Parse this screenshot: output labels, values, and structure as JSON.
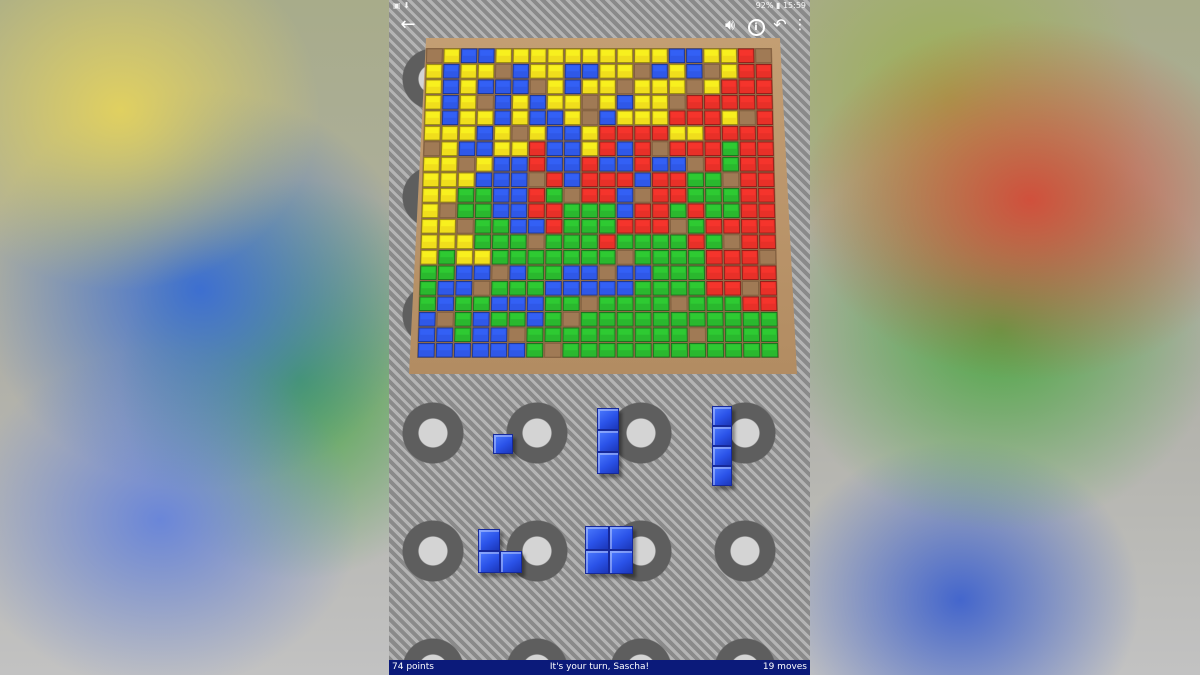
{
  "status_bar": {
    "left_icons": [
      "gallery-icon",
      "download-icon"
    ],
    "battery": "92%",
    "time": "15:59"
  },
  "toolbar": {
    "icons": [
      "back-arrow-icon",
      "speaker-icon",
      "info-icon",
      "undo-icon",
      "overflow-menu-icon"
    ]
  },
  "board": {
    "size": 20,
    "rows": [
      "YYBBYYYYYYYYYYBBYYRR",
      "YBYYBBYYBBYYBBYBBYRR",
      "YBYBBBYYBYYBYYYBYRRR",
      "YBYYBYBYYBYBYYYRRRRR",
      "YBYYBYBBYYBYYYRRRYRR",
      "YYYBYYYBBYRRRRYYRRRR",
      "YYBBYYRBBYRBRRRRRGRR",
      "YYYYBBRBBRBBRBBGRGRR",
      "YYYBBBRRBRRRBRRGGRRR",
      "YYGGBBRGRRRBGRRGGGRR",
      "YGGGBBRRGGGBRRGRGGRR",
      "YYGGGBBRGGGRRRGGRRRR",
      "YYYGGGGGGGRGGGGRGGRR",
      "YGYYGGGGGGGGGGGGRRRR",
      "GGBBBBGGBBBBBGGGRRRR",
      "GBBBGGGBBBBBGGGGRRRR",
      "GBGGBBBGGBGGGGGGGGRR",
      "BBGBGGBGGGGGGGGGGGGG",
      "BBGBBGGGGGGGGGGGGGGG",
      "BBBBBBGGGGGGGGGGGGGG"
    ],
    "empty_cells": [
      [
        0,
        0
      ],
      [
        0,
        19
      ],
      [
        1,
        4
      ],
      [
        1,
        12
      ],
      [
        2,
        6
      ],
      [
        2,
        15
      ],
      [
        3,
        3
      ],
      [
        3,
        9
      ],
      [
        4,
        18
      ],
      [
        5,
        5
      ],
      [
        6,
        13
      ],
      [
        7,
        2
      ],
      [
        8,
        17
      ],
      [
        9,
        8
      ],
      [
        10,
        1
      ],
      [
        11,
        14
      ],
      [
        12,
        6
      ],
      [
        13,
        11
      ],
      [
        14,
        4
      ],
      [
        15,
        18
      ],
      [
        16,
        9
      ],
      [
        17,
        1
      ],
      [
        18,
        15
      ],
      [
        19,
        7
      ],
      [
        3,
        14
      ],
      [
        8,
        6
      ],
      [
        11,
        2
      ],
      [
        16,
        14
      ],
      [
        6,
        0
      ],
      [
        13,
        19
      ],
      [
        1,
        16
      ],
      [
        18,
        5
      ],
      [
        9,
        12
      ],
      [
        4,
        9
      ],
      [
        15,
        3
      ],
      [
        12,
        17
      ],
      [
        2,
        11
      ],
      [
        17,
        8
      ],
      [
        7,
        15
      ],
      [
        14,
        10
      ]
    ],
    "colors": {
      "Y": "#f0de1c",
      "B": "#2f58e8",
      "R": "#e83028",
      "G": "#2ab82e"
    }
  },
  "tray": {
    "piece_color": "#2f58e8",
    "pieces": [
      {
        "id": "monomino",
        "cells": [
          [
            0,
            0
          ]
        ]
      },
      {
        "id": "domino-vertical",
        "cells": [
          [
            0,
            0
          ],
          [
            1,
            0
          ],
          [
            2,
            0
          ]
        ]
      },
      {
        "id": "tetromino-vertical",
        "cells": [
          [
            0,
            0
          ],
          [
            1,
            0
          ],
          [
            2,
            0
          ],
          [
            3,
            0
          ]
        ]
      },
      {
        "id": "l-tromino",
        "cells": [
          [
            0,
            0
          ],
          [
            1,
            0
          ],
          [
            1,
            1
          ]
        ]
      },
      {
        "id": "square-tetromino",
        "cells": [
          [
            0,
            0
          ],
          [
            0,
            1
          ],
          [
            1,
            0
          ],
          [
            1,
            1
          ]
        ]
      }
    ]
  },
  "footer": {
    "points": "74 points",
    "message": "It's your turn, Sascha!",
    "moves": "19 moves"
  }
}
